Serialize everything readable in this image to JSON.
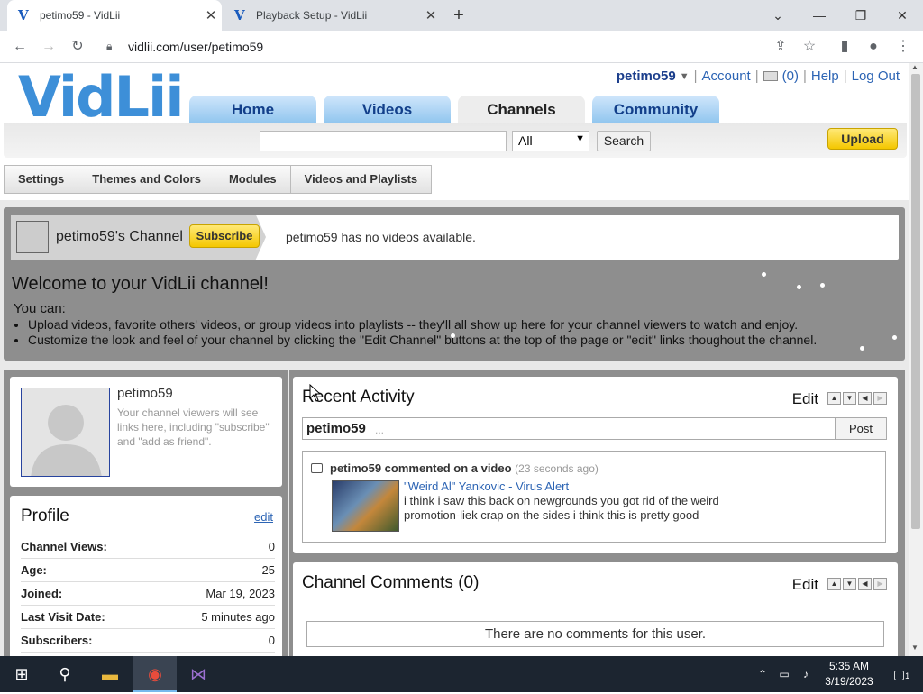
{
  "browser": {
    "tabs": [
      {
        "title": "petimo59 - VidLii",
        "active": true
      },
      {
        "title": "Playback Setup - VidLii",
        "active": false
      }
    ],
    "url": "vidlii.com/user/petimo59"
  },
  "site": {
    "logo": "VidLii",
    "user_nav": {
      "username": "petimo59",
      "account": "Account",
      "inbox_count": "(0)",
      "help": "Help",
      "logout": "Log Out"
    },
    "main_tabs": [
      "Home",
      "Videos",
      "Channels",
      "Community"
    ],
    "search": {
      "value": "",
      "category": "All",
      "button": "Search"
    },
    "upload": "Upload",
    "sub_tabs": [
      "Settings",
      "Themes and Colors",
      "Modules",
      "Videos and Playlists"
    ]
  },
  "channel": {
    "name": "petimo59's Channel",
    "subscribe": "Subscribe",
    "no_videos": "petimo59 has no videos available.",
    "welcome_title": "Welcome to your VidLii channel!",
    "you_can": "You can:",
    "bullets": [
      "Upload videos, favorite others' videos, or group videos into playlists -- they'll all show up here for your channel viewers to watch and enjoy.",
      "Customize the look and feel of your channel by clicking the \"Edit Channel\" buttons at the top of the page or \"edit\" links thoughout the channel."
    ]
  },
  "profile_box": {
    "username": "petimo59",
    "hint": "Your channel viewers will see links here, including \"subscribe\" and \"add as friend\"."
  },
  "profile": {
    "title": "Profile",
    "edit": "edit",
    "rows": [
      {
        "k": "Channel Views:",
        "v": "0"
      },
      {
        "k": "Age:",
        "v": "25"
      },
      {
        "k": "Joined:",
        "v": "Mar 19, 2023"
      },
      {
        "k": "Last Visit Date:",
        "v": "5 minutes ago"
      },
      {
        "k": "Subscribers:",
        "v": "0"
      }
    ]
  },
  "recent_activity": {
    "title": "Recent Activity",
    "edit": "Edit",
    "input_user": "petimo59",
    "input_ellipsis": "...",
    "post": "Post",
    "item": {
      "header": "petimo59 commented on a video",
      "time": "(23 seconds ago)",
      "video_title": "\"Weird Al\" Yankovic - Virus Alert",
      "comment": "i think i saw this back on newgrounds you got rid of the weird promotion-liek crap on the sides i think this is pretty good"
    }
  },
  "channel_comments": {
    "title": "Channel Comments (0)",
    "edit": "Edit",
    "empty": "There are no comments for this user."
  },
  "taskbar": {
    "time": "5:35 AM",
    "date": "3/19/2023",
    "notifications": "1"
  }
}
